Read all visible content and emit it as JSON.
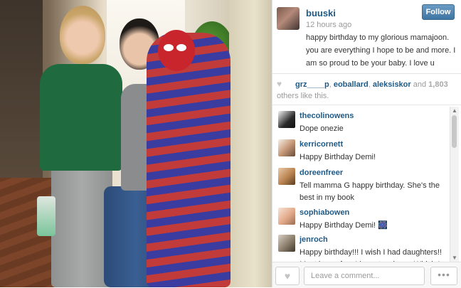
{
  "post": {
    "username": "buuski",
    "time": "12 hours ago",
    "caption": "happy birthday to my glorious mamajoon. you are everything I hope to be and more. I am so proud to be your baby. I love u",
    "follow_label": "Follow"
  },
  "likes": {
    "likers": [
      "grz____p",
      "eoballard",
      "aleksiskor"
    ],
    "sep1": ", ",
    "sep2": ", ",
    "and_text": " and ",
    "count": "1,803",
    "suffix": " others like this."
  },
  "comments": [
    {
      "username": "thecolinowens",
      "text": "Dope onezie"
    },
    {
      "username": "kerricornett",
      "text": "Happy Birthday Demi!"
    },
    {
      "username": "doreenfreer",
      "text": "Tell mamma G happy birthday. She's the best in my book"
    },
    {
      "username": "sophiabowen",
      "text": "Happy Birthday Demi! 🎆"
    },
    {
      "username": "jenroch",
      "text": "Happy birthday!!! I wish I had daughters!! Must be so fun. I have two boys. Which I"
    }
  ],
  "footer": {
    "comment_placeholder": "Leave a comment...",
    "more_label": "•••"
  },
  "icons": {
    "like": "heart-icon",
    "more": "ellipsis-icon"
  },
  "colors": {
    "link": "#1f5a86",
    "follow_button": "#4a7fae",
    "muted": "#9a9a9a"
  }
}
